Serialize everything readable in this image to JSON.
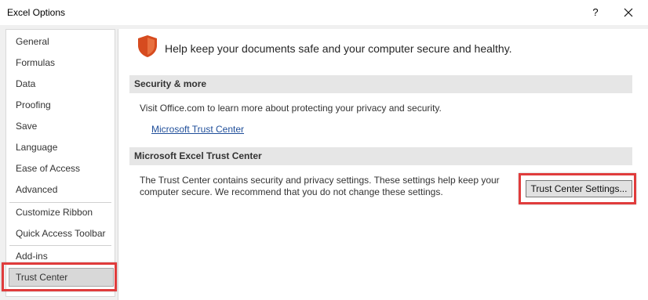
{
  "window": {
    "title": "Excel Options",
    "help_label": "?"
  },
  "sidebar": {
    "items": [
      {
        "label": "General"
      },
      {
        "label": "Formulas"
      },
      {
        "label": "Data"
      },
      {
        "label": "Proofing"
      },
      {
        "label": "Save"
      },
      {
        "label": "Language"
      },
      {
        "label": "Ease of Access"
      },
      {
        "label": "Advanced"
      },
      {
        "label": "Customize Ribbon"
      },
      {
        "label": "Quick Access Toolbar"
      },
      {
        "label": "Add-ins"
      },
      {
        "label": "Trust Center",
        "selected": true
      }
    ]
  },
  "main": {
    "heading": "Help keep your documents safe and your computer secure and healthy.",
    "security_section": {
      "title": "Security & more",
      "text": "Visit Office.com to learn more about protecting your privacy and security.",
      "link": "Microsoft Trust Center"
    },
    "trust_section": {
      "title": "Microsoft Excel Trust Center",
      "text_line1": "The Trust Center contains security and privacy settings. These settings help keep your",
      "text_line2": "computer secure. We recommend that you do not change these settings.",
      "button_label": "Trust Center Settings..."
    }
  },
  "colors": {
    "highlight": "#e03c3c",
    "shield": "#d64b1f",
    "link": "#1f4e9a"
  },
  "icons": {
    "shield": "shield-icon",
    "close": "close-icon"
  }
}
